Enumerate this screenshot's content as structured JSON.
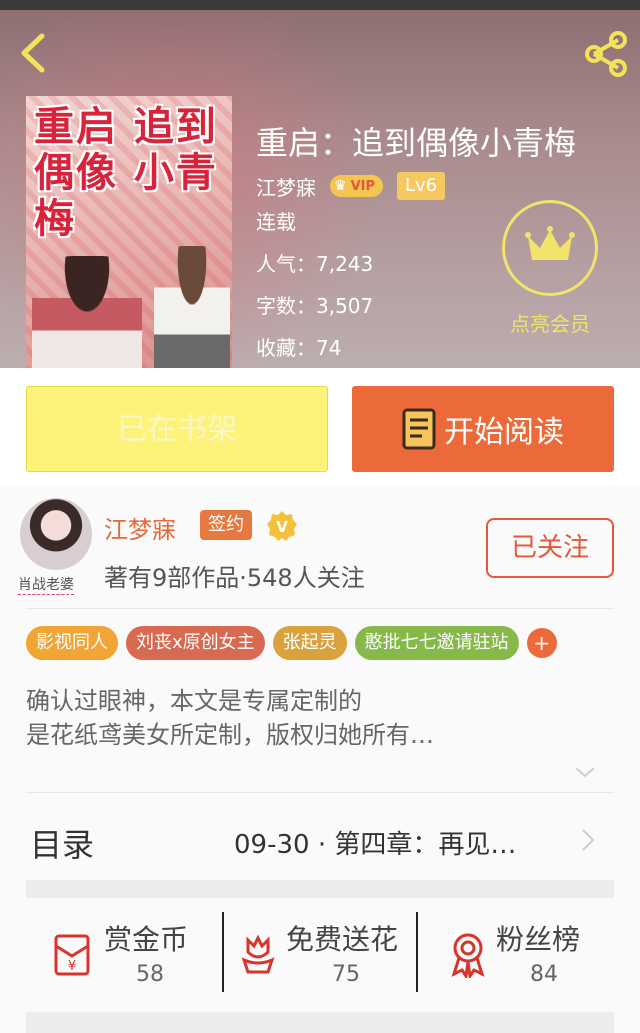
{
  "book": {
    "title": "重启：追到偶像小青梅",
    "author": "江梦寐",
    "vip_label": "VIP",
    "level": "Lv6",
    "status": "连载",
    "popularity": "人气：7,243",
    "word_count": "字数：3,507",
    "favorites": "收藏：74",
    "cover_title": "重启 追到 偶像 小青 梅"
  },
  "member": {
    "label": "点亮会员"
  },
  "actions": {
    "shelf_label": "已在书架",
    "read_label": "开始阅读"
  },
  "author_card": {
    "avatar_tag": "肖战老婆",
    "name": "江梦寐",
    "sign_label": "签约",
    "verify_mark": "V",
    "stats": "著有9部作品·548人关注",
    "follow_label": "已关注"
  },
  "tags": [
    {
      "label": "影视同人",
      "color": "#f0a535"
    },
    {
      "label": "刘丧x原创女主",
      "color": "#d96a52"
    },
    {
      "label": "张起灵",
      "color": "#d9a23c"
    },
    {
      "label": "憨批七七邀请驻站",
      "color": "#86b84a"
    }
  ],
  "tag_more": "+",
  "summary": {
    "line1": "确认过眼神，本文是专属定制的",
    "line2": "是花纸鸢美女所定制，版权归她所有…"
  },
  "toc": {
    "label": "目录",
    "latest": "09-30 · 第四章：再见…"
  },
  "rewards": [
    {
      "label": "赏金币",
      "value": "58",
      "icon": "red-envelope-icon"
    },
    {
      "label": "免费送花",
      "value": "75",
      "icon": "flower-icon"
    },
    {
      "label": "粉丝榜",
      "value": "84",
      "icon": "medal-icon"
    }
  ],
  "colors": {
    "accent": "#ec6a3a",
    "shelf_yellow": "#fdf37a",
    "member_yellow": "#f2e36a"
  }
}
